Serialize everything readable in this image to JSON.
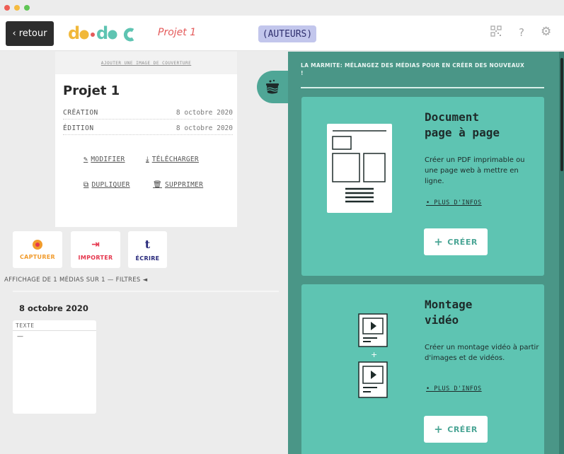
{
  "window": {
    "dots": [
      "#ee5e55",
      "#f5bb40",
      "#5fc555"
    ]
  },
  "topbar": {
    "back_label": "retour",
    "back_chevron": "‹",
    "logo_text": "do•doc",
    "project_name": "Projet 1",
    "authors_label": "(AUTEURS)",
    "icons": [
      "qr-code-icon",
      "help-icon",
      "settings-icon"
    ],
    "help_glyph": "?",
    "settings_glyph": "⚙"
  },
  "meta": {
    "cover_label": "AJOUTER UNE IMAGE DE COUVERTURE",
    "title": "Projet 1",
    "rows": [
      {
        "label": "CRÉATION",
        "value": "8 octobre 2020"
      },
      {
        "label": "ÉDITION",
        "value": "8 octobre 2020"
      }
    ],
    "actions": {
      "edit": "MODIFIER",
      "download": "TÉLÉCHARGER",
      "duplicate": "DUPLIQUER",
      "delete": "SUPPRIMER"
    }
  },
  "tools": {
    "capture": {
      "label": "CAPTURER",
      "color": "#f19b2c"
    },
    "import": {
      "label": "IMPORTER",
      "color": "#e5364d",
      "glyph": "⇥"
    },
    "write": {
      "label": "ÉCRIRE",
      "color": "#27287a",
      "glyph": "t"
    }
  },
  "media_list": {
    "count_text": "AFFICHAGE DE 1 MÉDIAS SUR 1 — FILTRES ◄",
    "date_heading": "8 octobre 2020",
    "items": [
      {
        "type": "TEXTE",
        "content": "—"
      }
    ]
  },
  "marmite": {
    "title": "LA MARMITE: MÉLANGEZ DES MÉDIAS POUR EN CRÉER DES NOUVEAUX !",
    "recipes": [
      {
        "title_line1": "Document",
        "title_line2": "page à page",
        "description": "Créer un PDF imprimable ou une page web à mettre en ligne.",
        "more_label": "• PLUS D'INFOS",
        "create_label": "CRÉER"
      },
      {
        "title_line1": "Montage",
        "title_line2": "vidéo",
        "description": "Créer un montage vidéo à partir d'images et de vidéos.",
        "more_label": "• PLUS D'INFOS",
        "create_label": "CRÉER"
      }
    ]
  },
  "colors": {
    "accent_teal": "#5ec4b2",
    "panel_teal": "#4a9687",
    "project_red": "#e45a5a",
    "authors_bg": "#c2c6ec"
  }
}
